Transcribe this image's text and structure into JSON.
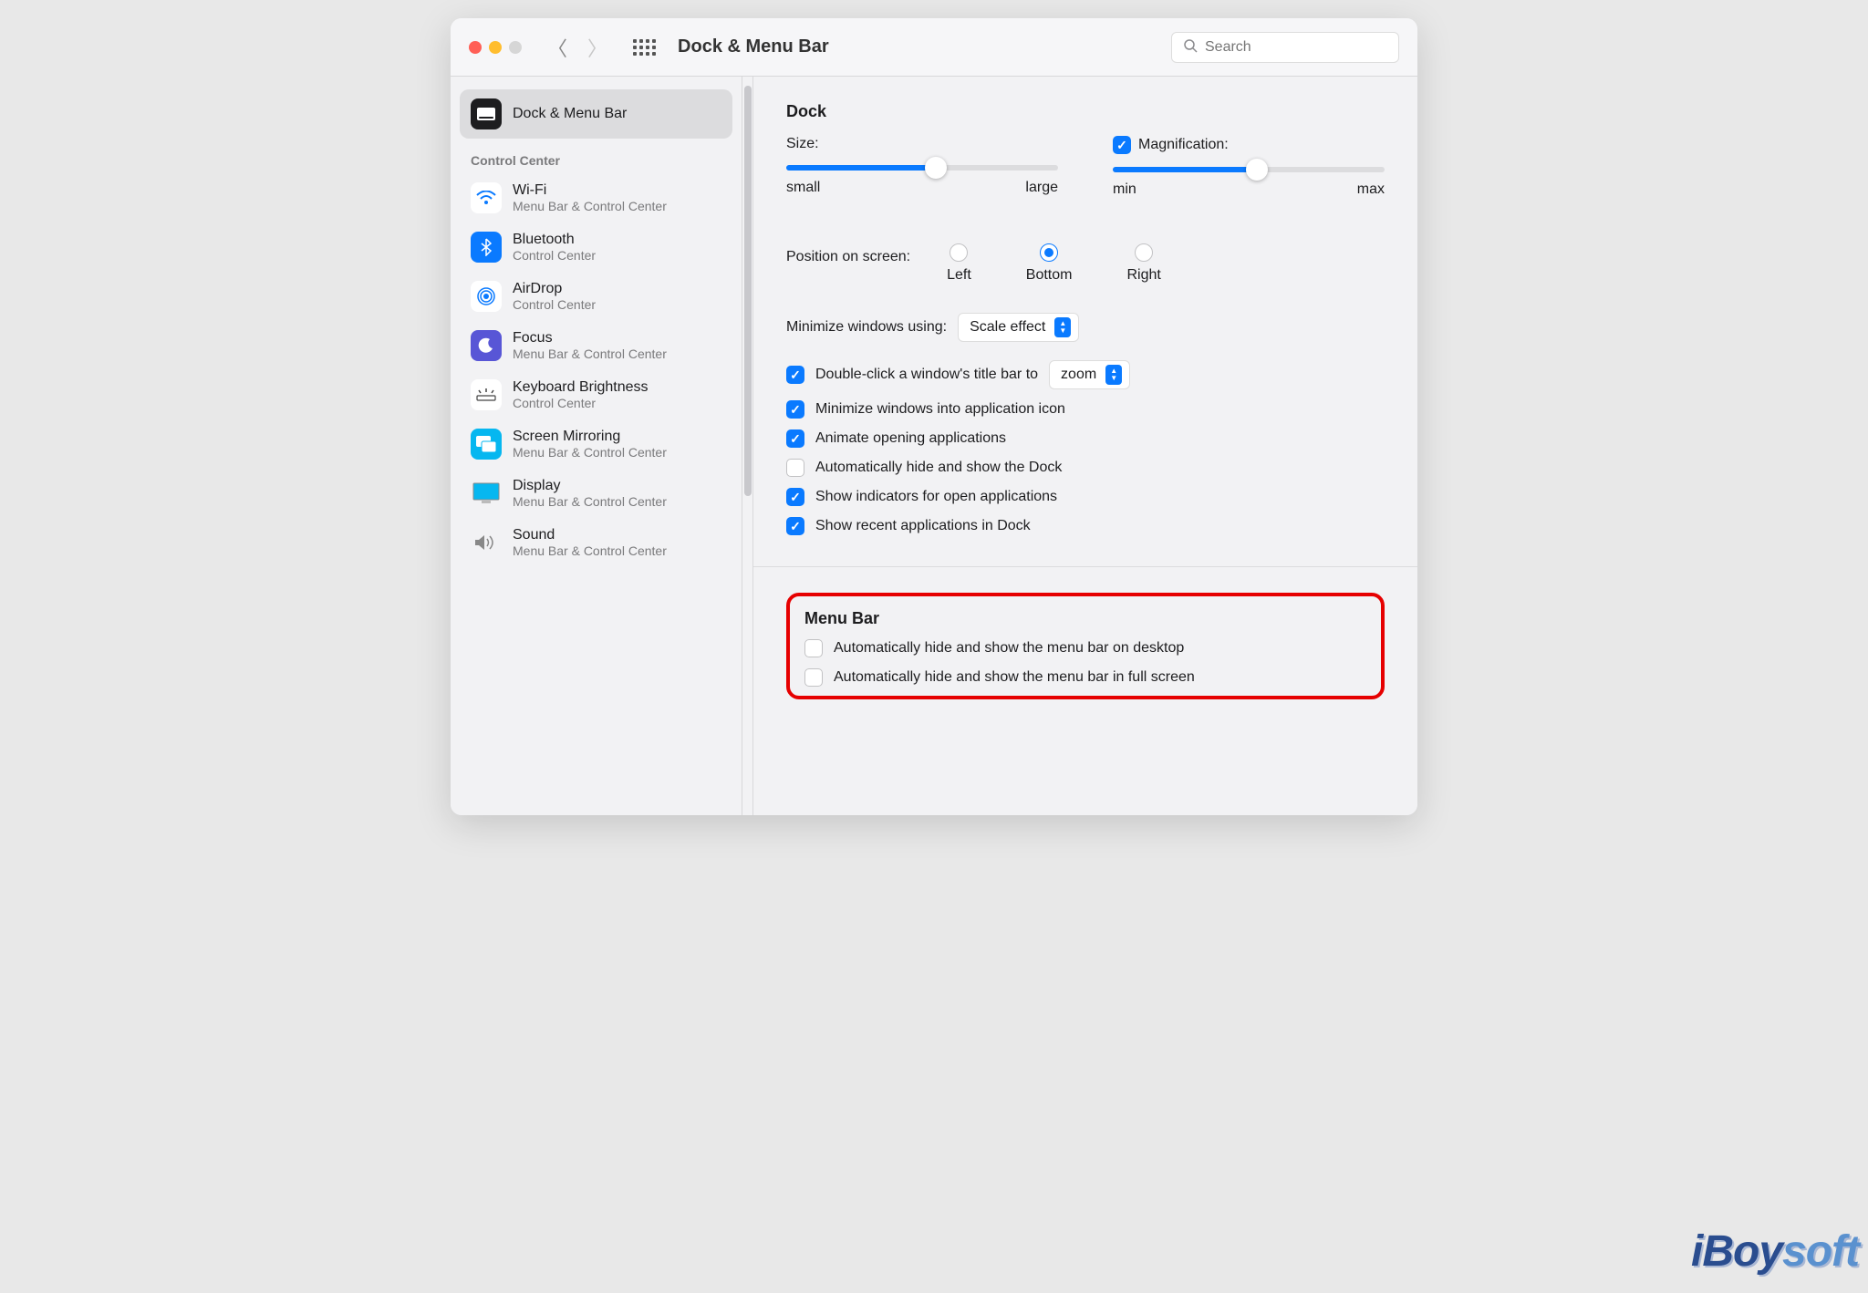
{
  "titlebar": {
    "title": "Dock & Menu Bar",
    "search_placeholder": "Search"
  },
  "sidebar": {
    "selected": {
      "title": "Dock & Menu Bar"
    },
    "section_header": "Control Center",
    "items": [
      {
        "title": "Wi-Fi",
        "subtitle": "Menu Bar & Control Center"
      },
      {
        "title": "Bluetooth",
        "subtitle": "Control Center"
      },
      {
        "title": "AirDrop",
        "subtitle": "Control Center"
      },
      {
        "title": "Focus",
        "subtitle": "Menu Bar & Control Center"
      },
      {
        "title": "Keyboard Brightness",
        "subtitle": "Control Center"
      },
      {
        "title": "Screen Mirroring",
        "subtitle": "Menu Bar & Control Center"
      },
      {
        "title": "Display",
        "subtitle": "Menu Bar & Control Center"
      },
      {
        "title": "Sound",
        "subtitle": "Menu Bar & Control Center"
      }
    ]
  },
  "dock": {
    "section_title": "Dock",
    "size_label": "Size:",
    "size_min": "small",
    "size_max": "large",
    "mag_label": "Magnification:",
    "mag_min": "min",
    "mag_max": "max",
    "position_label": "Position on screen:",
    "positions": {
      "left": "Left",
      "bottom": "Bottom",
      "right": "Right"
    },
    "minimize_label": "Minimize windows using:",
    "minimize_value": "Scale effect",
    "doubleclick_label": "Double-click a window's title bar to",
    "doubleclick_value": "zoom",
    "min_into_app": "Minimize windows into application icon",
    "animate": "Animate opening applications",
    "autohide_dock": "Automatically hide and show the Dock",
    "indicators": "Show indicators for open applications",
    "recent": "Show recent applications in Dock"
  },
  "menubar": {
    "section_title": "Menu Bar",
    "hide_desktop": "Automatically hide and show the menu bar on desktop",
    "hide_fullscreen": "Automatically hide and show the menu bar in full screen"
  },
  "watermark": "iBoysoft"
}
